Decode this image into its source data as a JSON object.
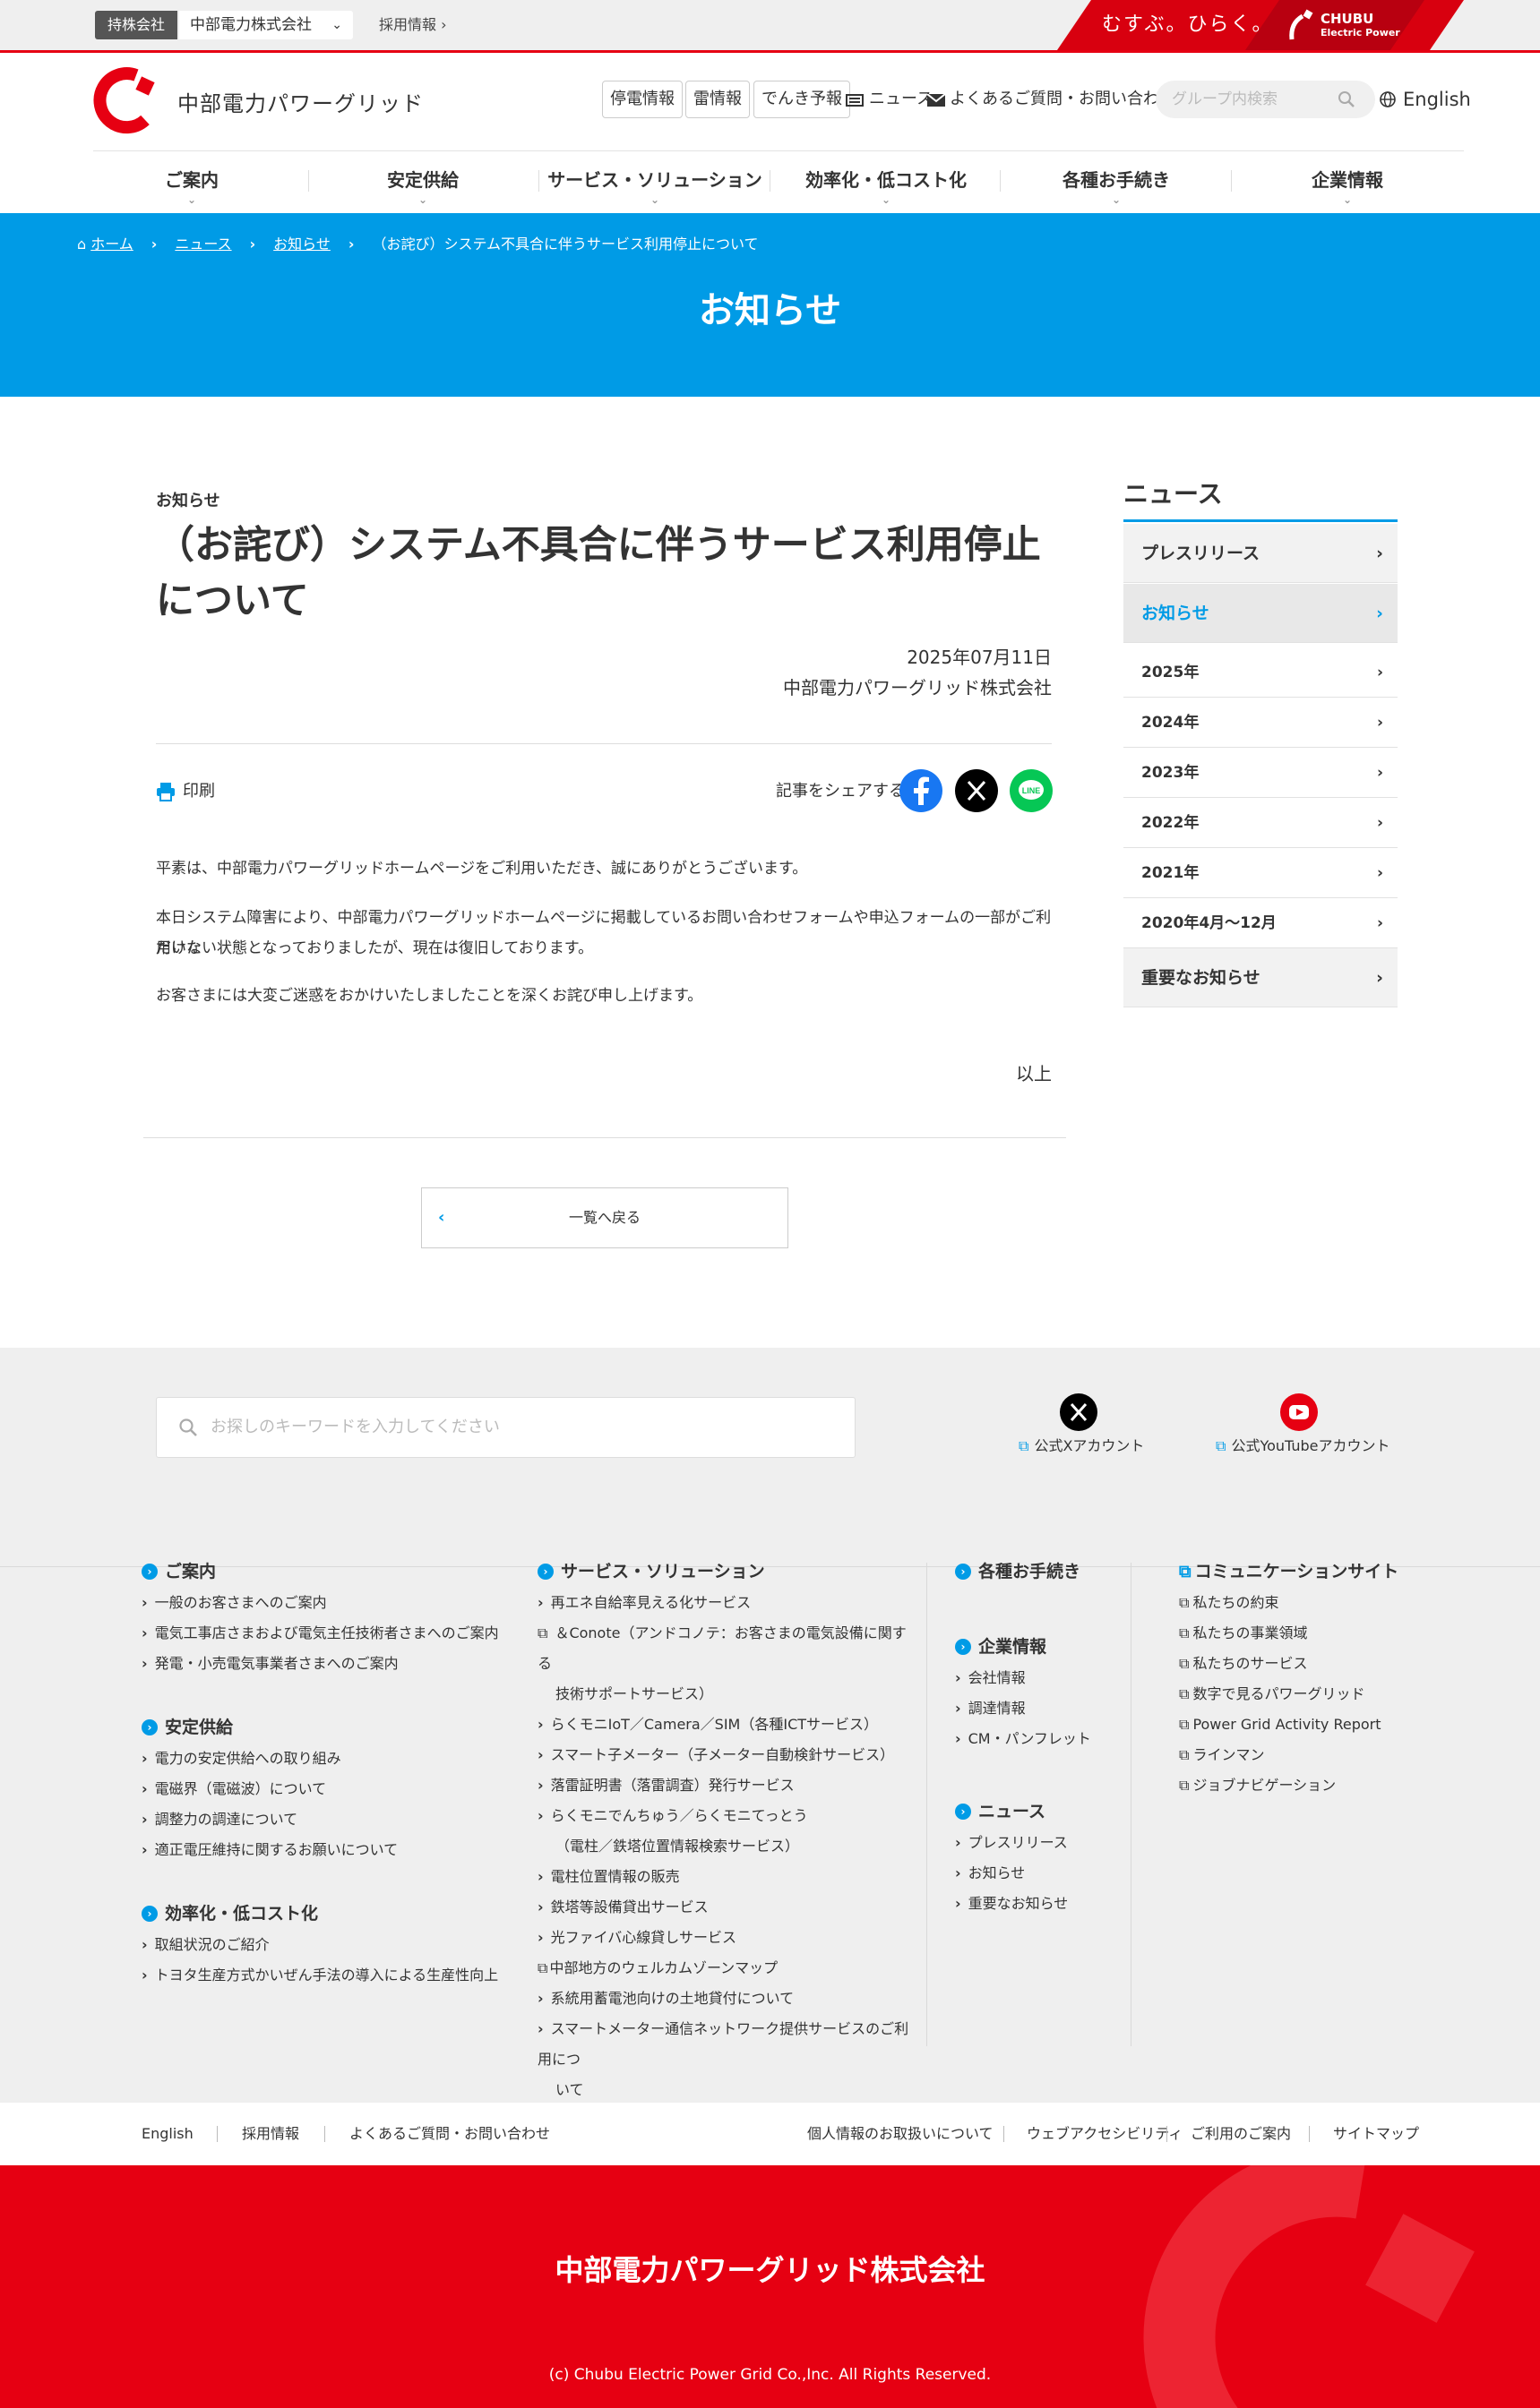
{
  "topbar": {
    "holding_label": "持株会社",
    "holding_select": "中部電力株式会社",
    "recruit": "採用情報",
    "slogan": "むすぶ。ひらく。",
    "chubu_logo_line1": "CHUBU",
    "chubu_logo_line2": "Electric Power"
  },
  "header": {
    "logo_text": "中部電力パワーグリッド",
    "btn_outage": "停電情報",
    "btn_lightning": "雷情報",
    "btn_forecast": "でんき予報",
    "news": "ニュース",
    "faq": "よくあるご質問・お問い合わせ",
    "search_placeholder": "グループ内検索",
    "english": "English"
  },
  "nav": [
    "ご案内",
    "安定供給",
    "サービス・ソリューション",
    "効率化・低コスト化",
    "各種お手続き",
    "企業情報"
  ],
  "breadcrumb": [
    "ホーム",
    "ニュース",
    "お知らせ",
    "（お詫び）システム不具合に伴うサービス利用停止について"
  ],
  "page_title": "お知らせ",
  "article": {
    "category": "お知らせ",
    "title": "（お詫び）システム不具合に伴うサービス利用停止について",
    "date": "2025年07月11日",
    "company": "中部電力パワーグリッド株式会社",
    "print": "印刷",
    "share": "記事をシェアする",
    "p1": "平素は、中部電力パワーグリッドホームページをご利用いただき、誠にありがとうございます。",
    "p2a": "本日システム障害により、中部電力パワーグリッドホームページに掲載しているお問い合わせフォームや申込フォームの一部がご利用いた",
    "p2b": "だけない状態となっておりましたが、現在は復旧しております。",
    "p3": "お客さまには大変ご迷惑をおかけいたしましたことを深くお詫び申し上げます。",
    "end": "以上",
    "back": "一覧へ戻る"
  },
  "sidebar": {
    "title": "ニュース",
    "items": [
      "プレスリリース",
      "お知らせ",
      "2025年",
      "2024年",
      "2023年",
      "2022年",
      "2021年",
      "2020年4月～12月",
      "重要なお知らせ"
    ]
  },
  "footer": {
    "search_placeholder": "お探しのキーワードを入力してください",
    "x_account": "公式Xアカウント",
    "youtube_account": "公式YouTubeアカウント",
    "col1": {
      "guide": {
        "head": "ご案内",
        "links": [
          "一般のお客さまへのご案内",
          "電気工事店さまおよび電気主任技術者さまへのご案内",
          "発電・小売電気事業者さまへのご案内"
        ]
      },
      "supply": {
        "head": "安定供給",
        "links": [
          "電力の安定供給への取り組み",
          "電磁界（電磁波）について",
          "調整力の調達について",
          "適正電圧維持に関するお願いについて"
        ]
      },
      "efficiency": {
        "head": "効率化・低コスト化",
        "links": [
          "取組状況のご紹介",
          "トヨタ生産方式かいぜん手法の導入による生産性向上"
        ]
      }
    },
    "col2": {
      "head": "サービス・ソリューション",
      "links": [
        "再エネ自給率見える化サービス",
        "＆Conote（アンドコノテ：お客さまの電気設備に関する",
        "技術サポートサービス）",
        "らくモニIoT／Camera／SIM（各種ICTサービス）",
        "スマート子メーター（子メーター自動検針サービス）",
        "落雷証明書（落雷調査）発行サービス",
        "らくモニでんちゅう／らくモニてっとう",
        "（電柱／鉄塔位置情報検索サービス）",
        "電柱位置情報の販売",
        "鉄塔等設備貸出サービス",
        "光ファイバ心線貸しサービス",
        "中部地方のウェルカムゾーンマップ",
        "系統用蓄電池向けの土地貸付について",
        "スマートメーター通信ネットワーク提供サービスのご利用につ",
        "いて"
      ]
    },
    "col3": {
      "procedures": {
        "head": "各種お手続き"
      },
      "corporate": {
        "head": "企業情報",
        "links": [
          "会社情報",
          "調達情報",
          "CM・パンフレット"
        ]
      },
      "news": {
        "head": "ニュース",
        "links": [
          "プレスリリース",
          "お知らせ",
          "重要なお知らせ"
        ]
      }
    },
    "col4": {
      "head": "コミュニケーションサイト",
      "links": [
        "私たちの約束",
        "私たちの事業領域",
        "私たちのサービス",
        "数字で見るパワーグリッド",
        "Power Grid Activity Report",
        "ラインマン",
        "ジョブナビゲーション"
      ]
    },
    "bottom_left": [
      "English",
      "採用情報",
      "よくあるご質問・お問い合わせ"
    ],
    "bottom_right": [
      "個人情報のお取扱いについて",
      "ウェブアクセシビリティ",
      "ご利用のご案内",
      "サイトマップ"
    ],
    "company": "中部電力パワーグリッド株式会社",
    "copyright": "(c) Chubu Electric Power Grid Co.,Inc. All Rights Reserved."
  },
  "colors": {
    "brand_red": "#e60012",
    "accent_blue": "#009be6"
  }
}
